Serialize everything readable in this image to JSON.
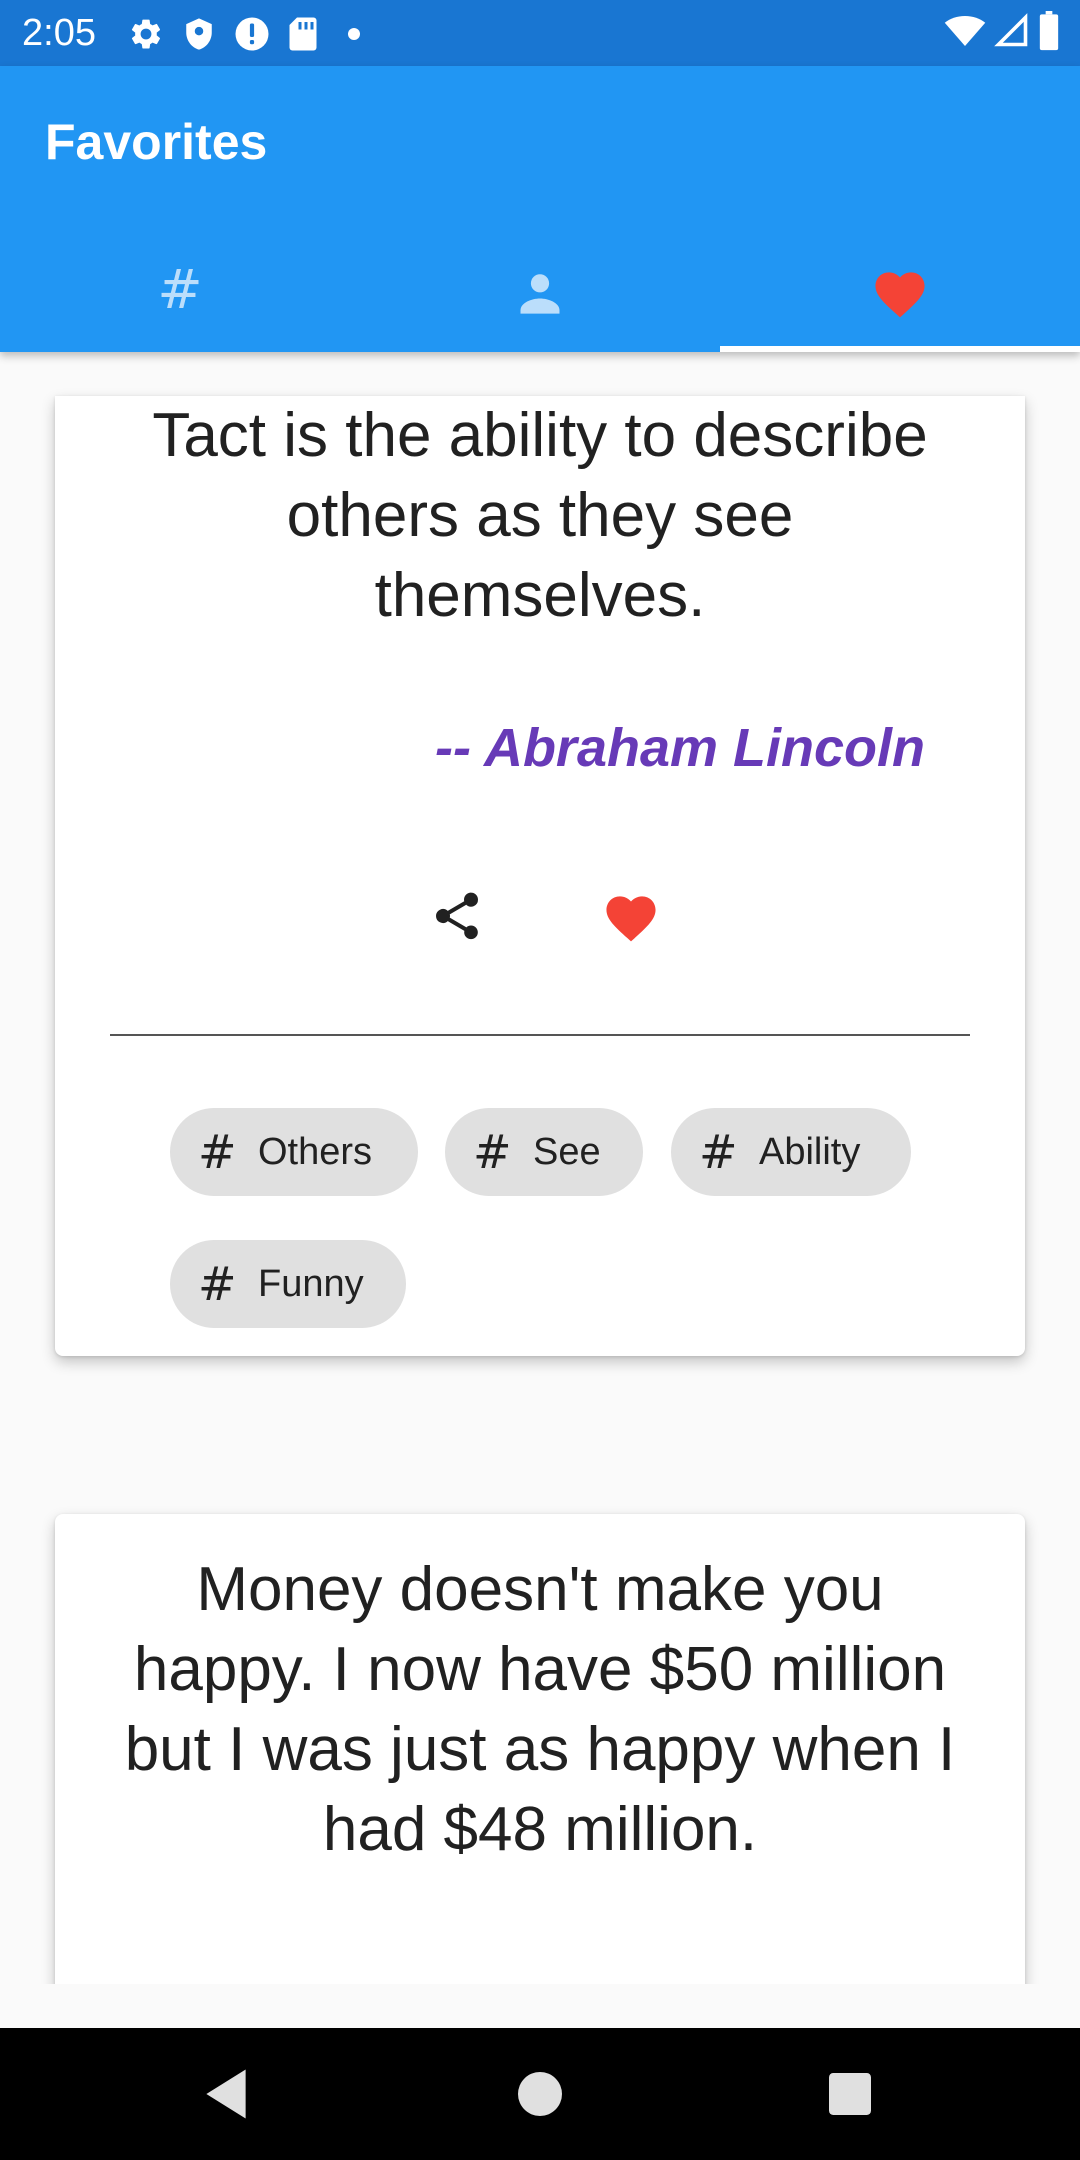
{
  "status_bar": {
    "time": "2:05",
    "left_icons": [
      "gear-icon",
      "shield-icon",
      "alert-icon",
      "sd-card-icon",
      "dot-icon"
    ],
    "right_icons": [
      "wifi-icon",
      "signal-icon",
      "battery-icon"
    ]
  },
  "app_bar": {
    "title": "Favorites",
    "tabs": [
      {
        "icon": "hash-icon",
        "glyph": "#",
        "selected": false
      },
      {
        "icon": "person-icon",
        "selected": false
      },
      {
        "icon": "heart-icon",
        "selected": true
      }
    ]
  },
  "quotes": [
    {
      "text": "Tact is the ability to describe others as they see themselves.",
      "author": "-- Abraham Lincoln",
      "favorited": true,
      "tags": [
        {
          "hash": "#",
          "label": "Others"
        },
        {
          "hash": "#",
          "label": "See"
        },
        {
          "hash": "#",
          "label": "Ability"
        },
        {
          "hash": "#",
          "label": "Funny"
        }
      ]
    },
    {
      "text": "Money doesn't make you happy. I now have $50 million but I was just as happy when I had $48 million."
    }
  ],
  "nav_bar": {
    "buttons": [
      "back-icon",
      "home-icon",
      "recents-icon"
    ]
  },
  "colors": {
    "status_bar": "#1976d2",
    "app_bar": "#2196f3",
    "author": "#673ab7",
    "heart": "#f44336",
    "chip": "#e0e0e0"
  }
}
